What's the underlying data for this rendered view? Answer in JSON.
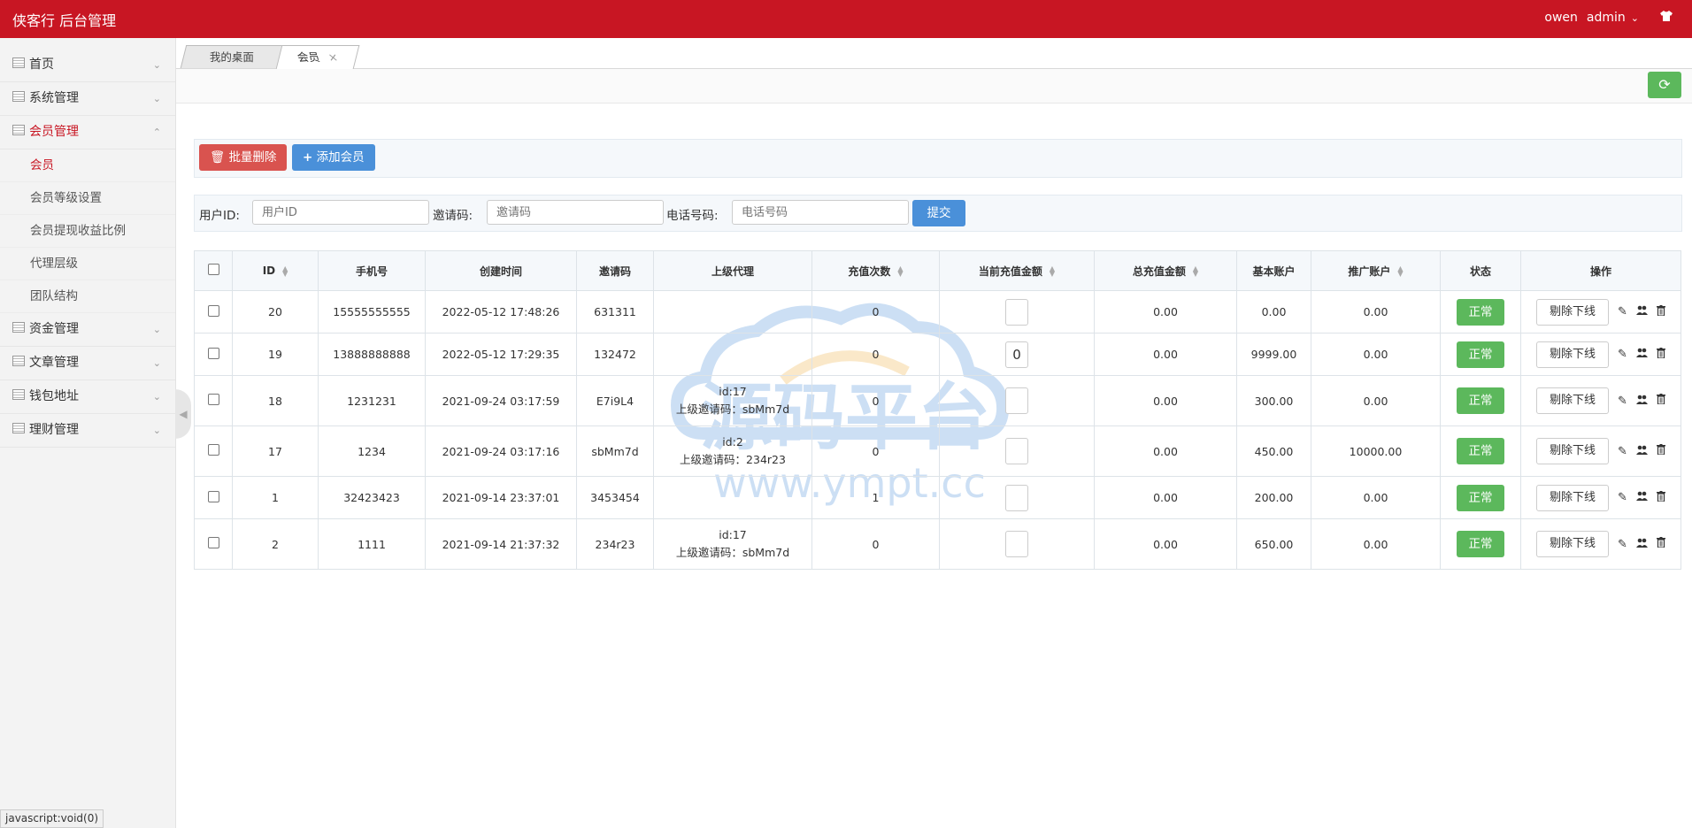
{
  "app": {
    "title": "侠客行 后台管理",
    "user": "owen",
    "role": "admin"
  },
  "sidebar": {
    "items": [
      {
        "label": "首页"
      },
      {
        "label": "系统管理"
      },
      {
        "label": "会员管理"
      },
      {
        "label": "资金管理"
      },
      {
        "label": "文章管理"
      },
      {
        "label": "钱包地址"
      },
      {
        "label": "理财管理"
      }
    ],
    "member_sub": [
      {
        "label": "会员"
      },
      {
        "label": "会员等级设置"
      },
      {
        "label": "会员提现收益比例"
      },
      {
        "label": "代理层级"
      },
      {
        "label": "团队结构"
      }
    ]
  },
  "tabs": [
    {
      "label": "我的桌面"
    },
    {
      "label": "会员"
    }
  ],
  "toolbar": {
    "batch_delete": "批量删除",
    "add_member": "添加会员"
  },
  "filters": {
    "user_id_label": "用户ID:",
    "user_id_placeholder": "用户ID",
    "invite_label": "邀请码:",
    "invite_placeholder": "邀请码",
    "phone_label": "电话号码:",
    "phone_placeholder": "电话号码",
    "submit": "提交"
  },
  "table": {
    "headers": {
      "id": "ID",
      "phone": "手机号",
      "created": "创建时间",
      "invite": "邀请码",
      "parent": "上级代理",
      "recharge_count": "充值次数",
      "current_amount": "当前充值金额",
      "total_amount": "总充值金额",
      "basic": "基本账户",
      "promo": "推广账户",
      "status": "状态",
      "ops": "操作"
    },
    "rows": [
      {
        "id": "20",
        "phone": "15555555555",
        "created": "2022-05-12 17:48:26",
        "invite": "631311",
        "parent_id": "",
        "parent_code": "",
        "count": "0",
        "current": "",
        "total": "0.00",
        "basic": "0.00",
        "promo": "0.00",
        "status": "正常",
        "kick": "剔除下线"
      },
      {
        "id": "19",
        "phone": "13888888888",
        "created": "2022-05-12 17:29:35",
        "invite": "132472",
        "parent_id": "",
        "parent_code": "",
        "count": "0",
        "current": "0",
        "total": "0.00",
        "basic": "9999.00",
        "promo": "0.00",
        "status": "正常",
        "kick": "剔除下线"
      },
      {
        "id": "18",
        "phone": "1231231",
        "created": "2021-09-24 03:17:59",
        "invite": "E7i9L4",
        "parent_id": "id:17",
        "parent_code": "上级邀请码：sbMm7d",
        "count": "0",
        "current": "",
        "total": "0.00",
        "basic": "300.00",
        "promo": "0.00",
        "status": "正常",
        "kick": "剔除下线"
      },
      {
        "id": "17",
        "phone": "1234",
        "created": "2021-09-24 03:17:16",
        "invite": "sbMm7d",
        "parent_id": "id:2",
        "parent_code": "上级邀请码：234r23",
        "count": "0",
        "current": "",
        "total": "0.00",
        "basic": "450.00",
        "promo": "10000.00",
        "status": "正常",
        "kick": "剔除下线"
      },
      {
        "id": "1",
        "phone": "32423423",
        "created": "2021-09-14 23:37:01",
        "invite": "3453454",
        "parent_id": "",
        "parent_code": "",
        "count": "1",
        "current": "",
        "total": "0.00",
        "basic": "200.00",
        "promo": "0.00",
        "status": "正常",
        "kick": "剔除下线"
      },
      {
        "id": "2",
        "phone": "1111",
        "created": "2021-09-14 21:37:32",
        "invite": "234r23",
        "parent_id": "id:17",
        "parent_code": "上级邀请码：sbMm7d",
        "count": "0",
        "current": "",
        "total": "0.00",
        "basic": "650.00",
        "promo": "0.00",
        "status": "正常",
        "kick": "剔除下线"
      }
    ]
  },
  "watermark": {
    "title": "源码平台",
    "url": "www.ympt.cc"
  },
  "statusbar": {
    "text": "javascript:void(0)"
  }
}
